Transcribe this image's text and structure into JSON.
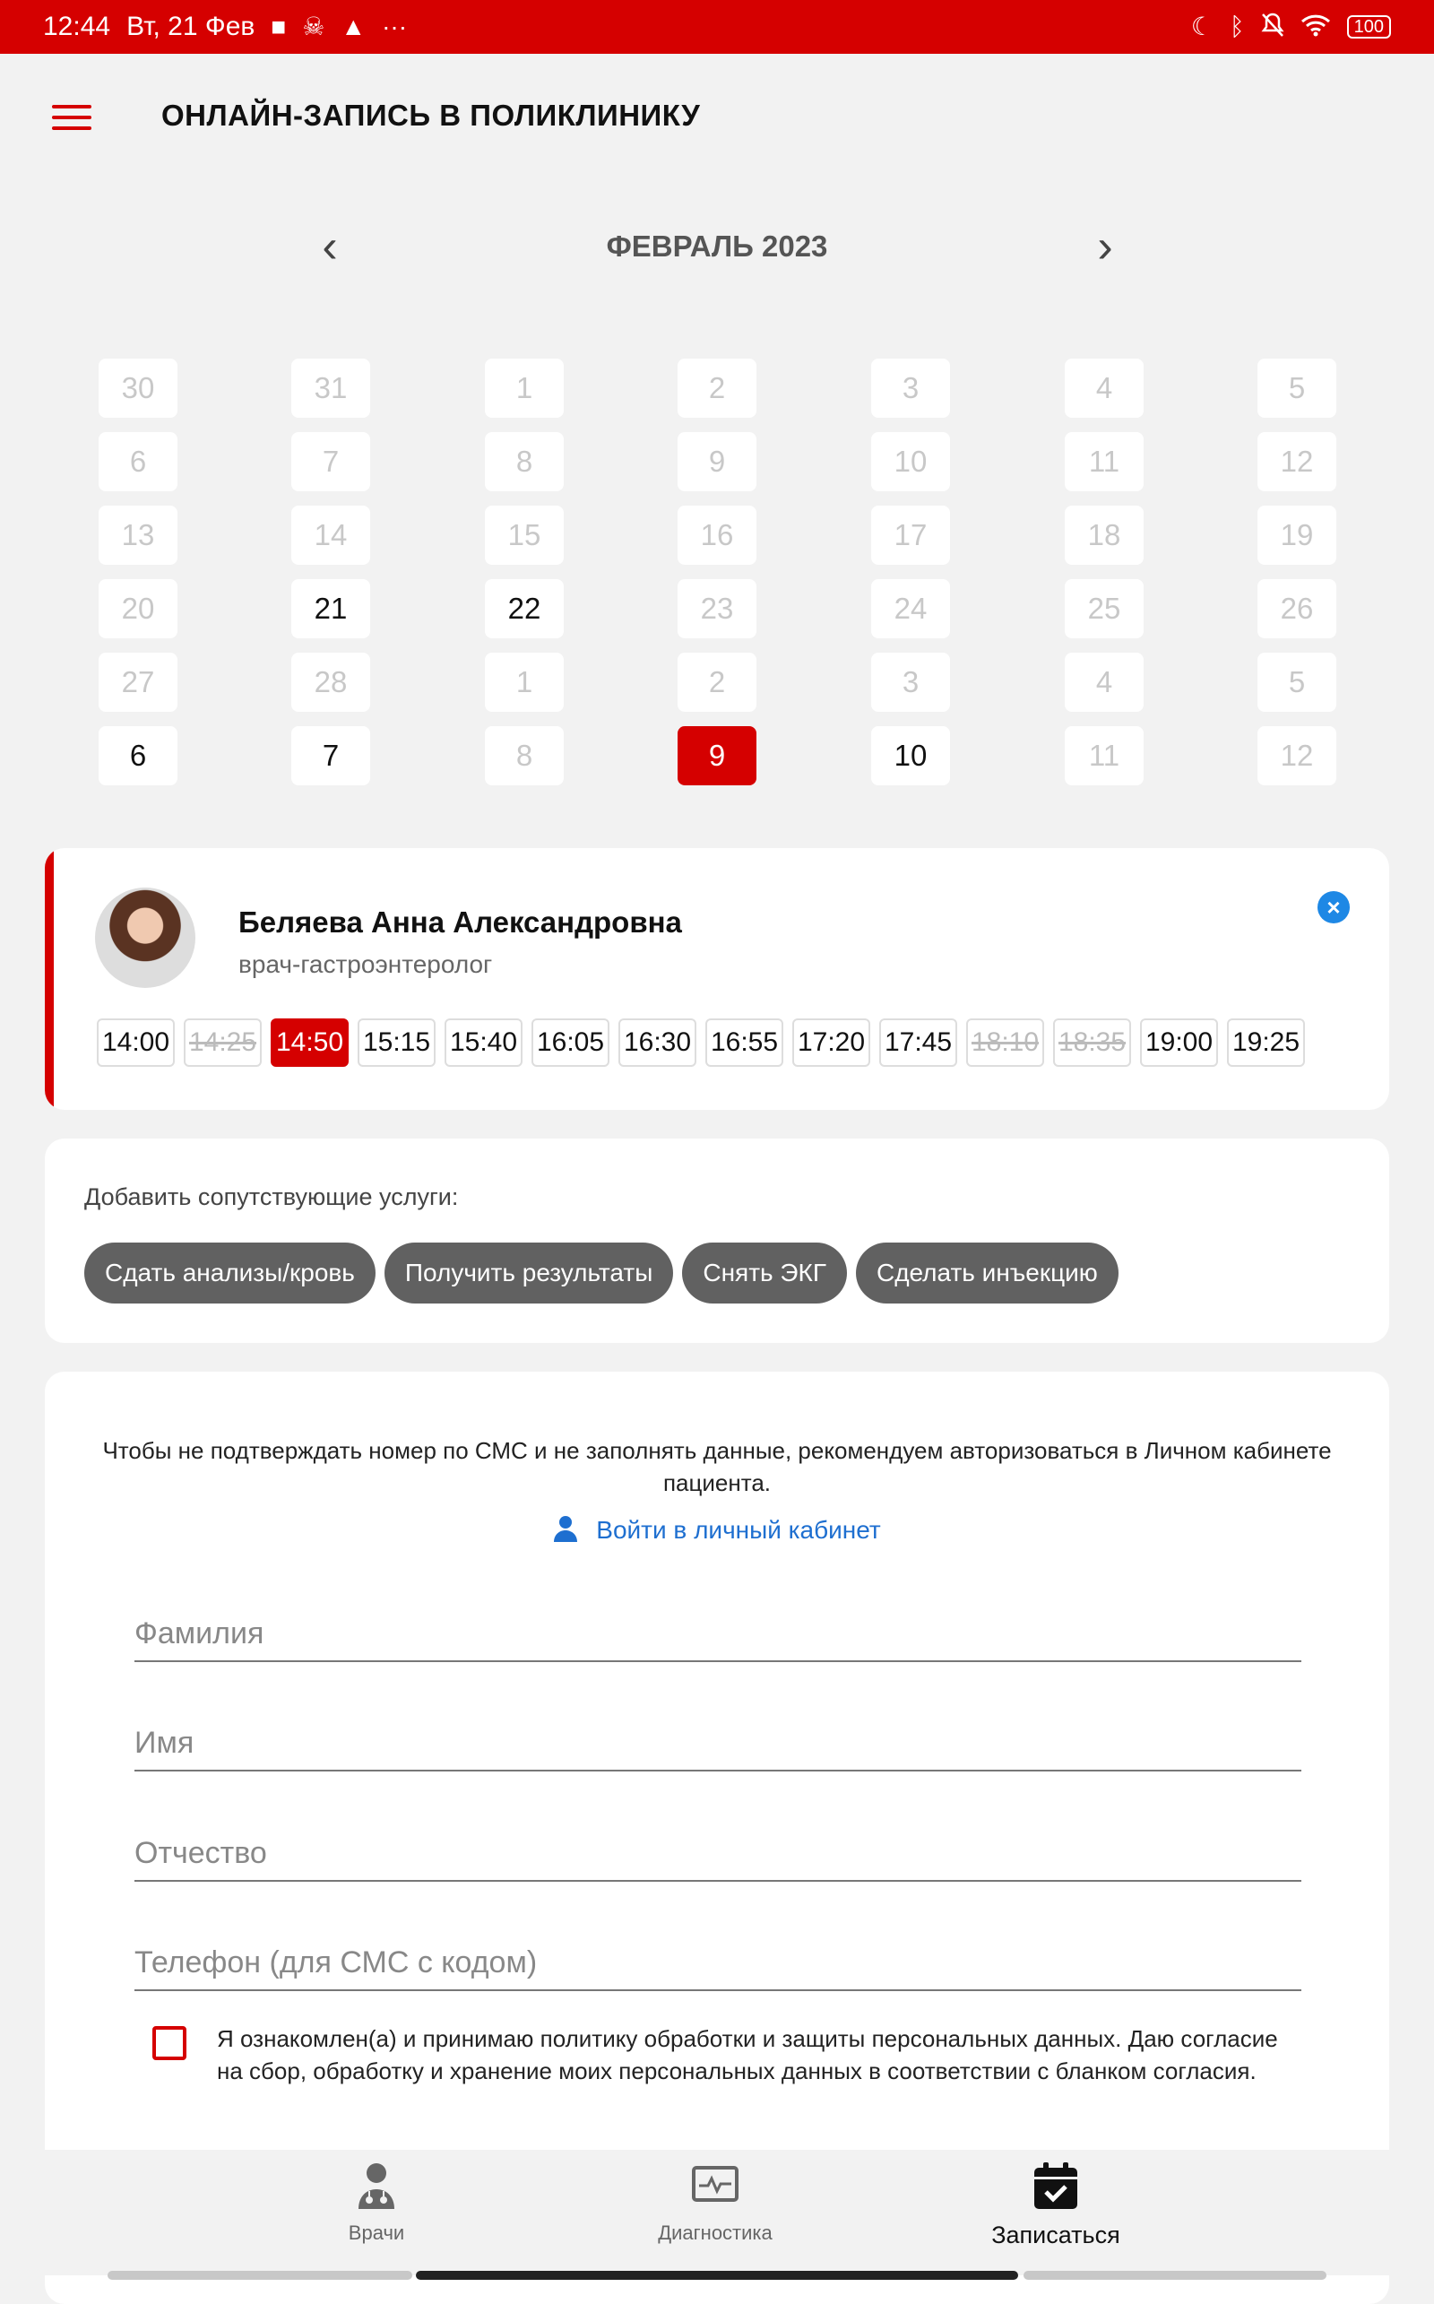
{
  "status_bar": {
    "time": "12:44",
    "date": "Вт, 21 Фев",
    "battery": "100",
    "icons_left": [
      "stop-icon",
      "skull-icon",
      "warning-icon",
      "more-icon"
    ],
    "icons_right": [
      "moon-icon",
      "bluetooth-icon",
      "bell-off-icon",
      "wifi-icon",
      "battery-icon"
    ]
  },
  "header": {
    "title": "ОНЛАЙН-ЗАПИСЬ В ПОЛИКЛИНИКУ"
  },
  "calendar": {
    "month_label": "ФЕВРАЛЬ 2023",
    "prev_glyph": "‹",
    "next_glyph": "›",
    "rows": [
      [
        {
          "d": "30",
          "s": "off"
        },
        {
          "d": "31",
          "s": "off"
        },
        {
          "d": "1",
          "s": "off"
        },
        {
          "d": "2",
          "s": "off"
        },
        {
          "d": "3",
          "s": "off"
        },
        {
          "d": "4",
          "s": "off"
        },
        {
          "d": "5",
          "s": "off"
        }
      ],
      [
        {
          "d": "6",
          "s": "off"
        },
        {
          "d": "7",
          "s": "off"
        },
        {
          "d": "8",
          "s": "off"
        },
        {
          "d": "9",
          "s": "off"
        },
        {
          "d": "10",
          "s": "off"
        },
        {
          "d": "11",
          "s": "off"
        },
        {
          "d": "12",
          "s": "off"
        }
      ],
      [
        {
          "d": "13",
          "s": "off"
        },
        {
          "d": "14",
          "s": "off"
        },
        {
          "d": "15",
          "s": "off"
        },
        {
          "d": "16",
          "s": "off"
        },
        {
          "d": "17",
          "s": "off"
        },
        {
          "d": "18",
          "s": "off"
        },
        {
          "d": "19",
          "s": "off"
        }
      ],
      [
        {
          "d": "20",
          "s": "off"
        },
        {
          "d": "21",
          "s": "on"
        },
        {
          "d": "22",
          "s": "on"
        },
        {
          "d": "23",
          "s": "off"
        },
        {
          "d": "24",
          "s": "off"
        },
        {
          "d": "25",
          "s": "off"
        },
        {
          "d": "26",
          "s": "off"
        }
      ],
      [
        {
          "d": "27",
          "s": "off"
        },
        {
          "d": "28",
          "s": "off"
        },
        {
          "d": "1",
          "s": "off"
        },
        {
          "d": "2",
          "s": "off"
        },
        {
          "d": "3",
          "s": "off"
        },
        {
          "d": "4",
          "s": "off"
        },
        {
          "d": "5",
          "s": "off"
        }
      ],
      [
        {
          "d": "6",
          "s": "on"
        },
        {
          "d": "7",
          "s": "on"
        },
        {
          "d": "8",
          "s": "off"
        },
        {
          "d": "9",
          "s": "selected"
        },
        {
          "d": "10",
          "s": "on"
        },
        {
          "d": "11",
          "s": "off"
        },
        {
          "d": "12",
          "s": "off"
        }
      ]
    ]
  },
  "doctor": {
    "name": "Беляева Анна Александровна",
    "specialty": "врач-гастроэнтеролог",
    "close_glyph": "×",
    "slots": [
      {
        "t": "14:00",
        "s": "on"
      },
      {
        "t": "14:25",
        "s": "off"
      },
      {
        "t": "14:50",
        "s": "selected"
      },
      {
        "t": "15:15",
        "s": "on"
      },
      {
        "t": "15:40",
        "s": "on"
      },
      {
        "t": "16:05",
        "s": "on"
      },
      {
        "t": "16:30",
        "s": "on"
      },
      {
        "t": "16:55",
        "s": "on"
      },
      {
        "t": "17:20",
        "s": "on"
      },
      {
        "t": "17:45",
        "s": "on"
      },
      {
        "t": "18:10",
        "s": "off"
      },
      {
        "t": "18:35",
        "s": "off"
      },
      {
        "t": "19:00",
        "s": "on"
      },
      {
        "t": "19:25",
        "s": "on"
      }
    ]
  },
  "services": {
    "title": "Добавить сопутствующие услуги:",
    "chips": [
      "Сдать анализы/кровь",
      "Получить результаты",
      "Снять ЭКГ",
      "Сделать инъекцию"
    ]
  },
  "form": {
    "notice": "Чтобы не подтверждать номер по СМС и не заполнять данные, рекомендуем авторизоваться в Личном кабинете пациента.",
    "login_label": "Войти в личный кабинет",
    "surname_placeholder": "Фамилия",
    "name_placeholder": "Имя",
    "patronymic_placeholder": "Отчество",
    "phone_placeholder": "Телефон (для СМС с кодом)",
    "consent_text": "Я ознакомлен(а) и принимаю политику обработки и защиты персональных данных. Даю согласие на сбор, обработку и хранение моих персональных данных в соответствии с бланком согласия."
  },
  "bottom_nav": {
    "doctors_label": "Врачи",
    "diagnostics_label": "Диагностика",
    "signup_label": "Записаться"
  },
  "colors": {
    "accent": "#d50000",
    "link": "#1e6fd0",
    "chip": "#616161",
    "background": "#f2f2f2"
  }
}
